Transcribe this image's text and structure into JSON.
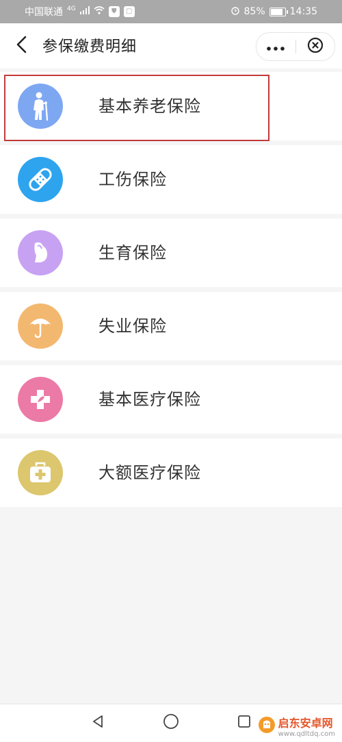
{
  "status_bar": {
    "carrier": "中国联通",
    "network": "4G",
    "battery_percent": "85%",
    "battery_level": 0.85,
    "time": "14:35"
  },
  "header": {
    "back_icon": "chevron-left-icon",
    "title": "参保缴费明细",
    "more_icon": "more-dots-icon",
    "close_icon": "close-circle-icon"
  },
  "insurance_items": [
    {
      "label": "基本养老保险",
      "icon": "elderly-person-icon",
      "color": "#7ea7f2",
      "selected": true
    },
    {
      "label": "工伤保险",
      "icon": "bandage-icon",
      "color": "#2ea4ee",
      "selected": false
    },
    {
      "label": "生育保险",
      "icon": "pregnant-icon",
      "color": "#c8a2f2",
      "selected": false
    },
    {
      "label": "失业保险",
      "icon": "umbrella-icon",
      "color": "#f3b86f",
      "selected": false
    },
    {
      "label": "基本医疗保险",
      "icon": "medical-cross-icon",
      "color": "#ec7aa6",
      "selected": false
    },
    {
      "label": "大额医疗保险",
      "icon": "first-aid-kit-icon",
      "color": "#dcc66e",
      "selected": false
    }
  ],
  "nav_bar": {
    "back_icon": "nav-back-triangle-icon",
    "home_icon": "nav-home-circle-icon",
    "recent_icon": "nav-recent-square-icon"
  },
  "watermark": {
    "name": "启东安卓网",
    "url": "www.qdltdq.com"
  }
}
